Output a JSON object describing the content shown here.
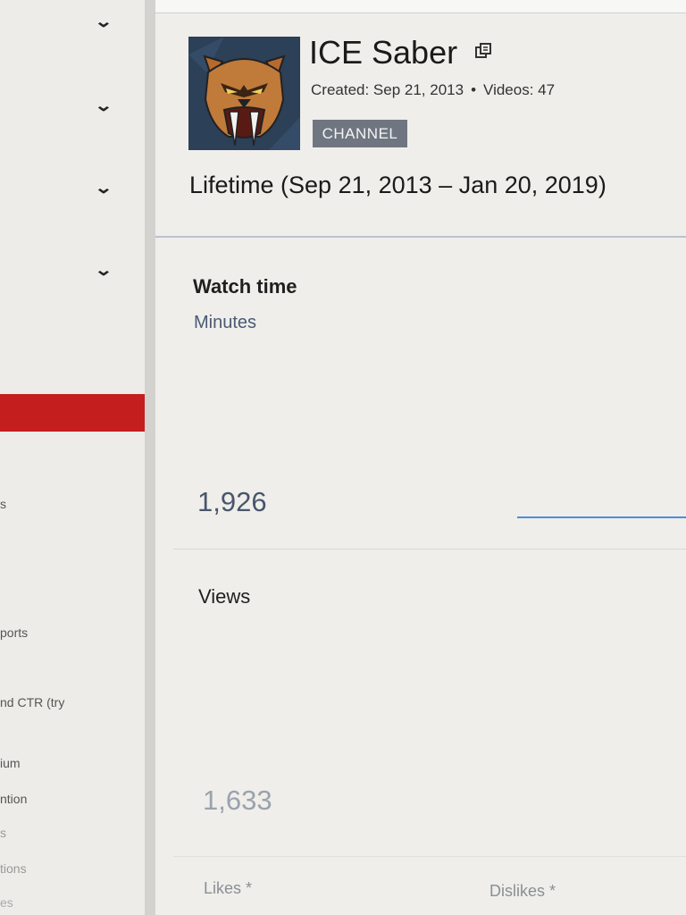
{
  "sidebar": {
    "fragments": [
      "s",
      "ports",
      "nd CTR (try",
      "ium",
      "ntion",
      "s",
      "tions",
      "es"
    ]
  },
  "channel": {
    "name": "ICE Saber",
    "created_label": "Created: Sep 21, 2013",
    "separator": "•",
    "videos_label": "Videos: 47",
    "badge": "CHANNEL"
  },
  "date_range": "Lifetime (Sep 21, 2013 – Jan 20, 2019)",
  "metrics": {
    "watch_time": {
      "label": "Watch time",
      "unit": "Minutes",
      "value": "1,926"
    },
    "views": {
      "label": "Views",
      "value": "1,633"
    },
    "likes": {
      "label": "Likes *"
    },
    "dislikes": {
      "label": "Dislikes *"
    }
  },
  "colors": {
    "accent_red": "#c41e1e",
    "badge_gray": "#6f7681",
    "sparkline_blue": "#4a90d9"
  },
  "icons": {
    "sidebar_expand": "chevron-down-icon",
    "channel_link": "external-link-icon",
    "avatar": "saber-tooth-tiger-logo"
  }
}
